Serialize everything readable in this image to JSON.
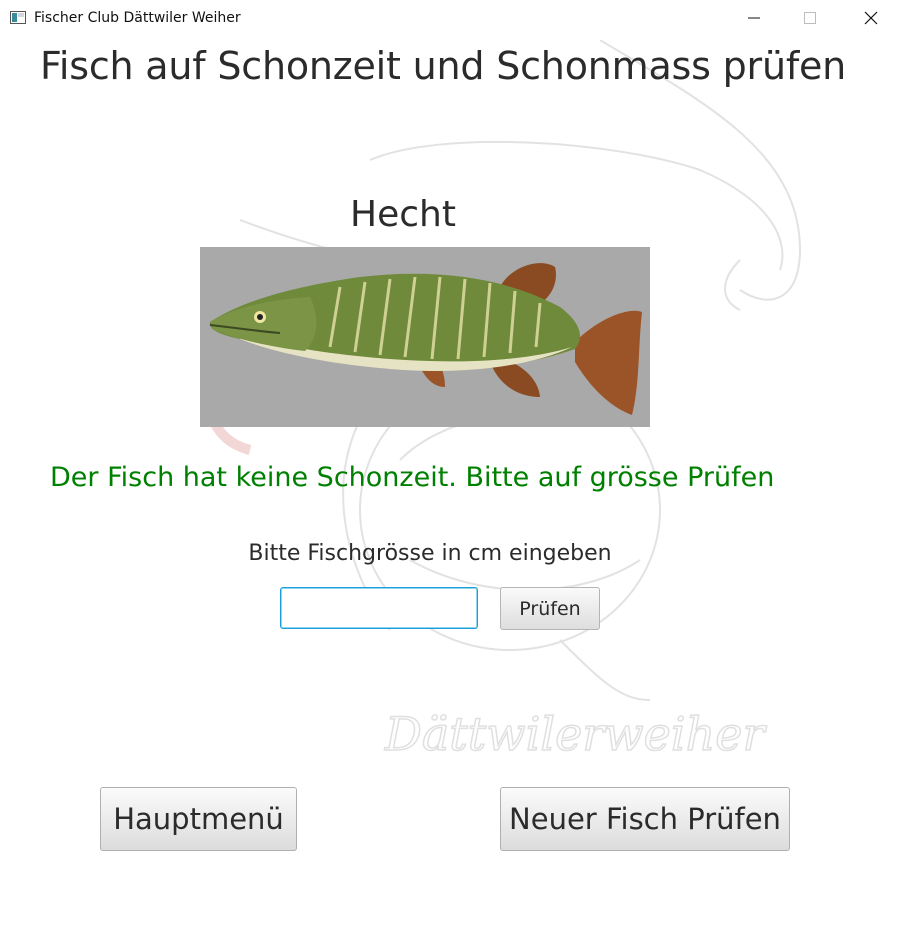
{
  "window": {
    "title": "Fischer Club Dättwiler Weiher",
    "icon": "app-window-icon",
    "controls": [
      "minimize-icon",
      "maximize-icon",
      "close-icon"
    ]
  },
  "page": {
    "title": "Fisch auf Schonzeit und Schonmass prüfen"
  },
  "watermark": {
    "text": "Dättwilerweiher"
  },
  "fish": {
    "name": "Hecht",
    "image": "pike-fish-image"
  },
  "status": {
    "message": "Der Fisch hat keine Schonzeit. Bitte auf grösse Prüfen",
    "color": "#008000"
  },
  "size_check": {
    "label": "Bitte Fischgrösse in cm eingeben",
    "input_value": "",
    "button_label": "Prüfen"
  },
  "footer": {
    "main_menu_label": "Hauptmenü",
    "new_fish_label": "Neuer Fisch Prüfen"
  },
  "colors": {
    "accent_focus": "#1aa0d6",
    "image_background": "#a9a9a9"
  }
}
